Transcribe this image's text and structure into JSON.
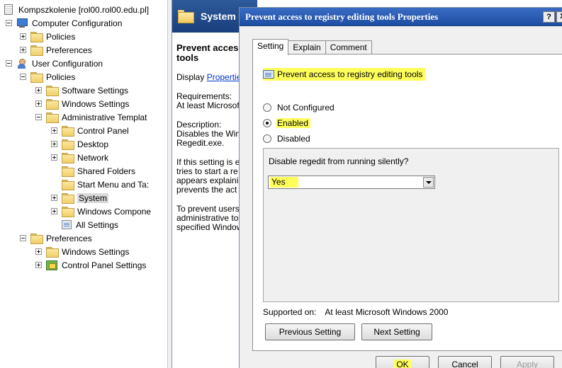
{
  "tree": {
    "root": "Kompszkolenie [rol00.rol00.edu.pl]",
    "computer_configuration": "Computer Configuration",
    "cc_policies": "Policies",
    "cc_preferences": "Preferences",
    "user_configuration": "User Configuration",
    "uc_policies": "Policies",
    "software_settings": "Software Settings",
    "windows_settings": "Windows Settings",
    "administrative_templates": "Administrative Templat",
    "control_panel": "Control Panel",
    "desktop": "Desktop",
    "network": "Network",
    "shared_folders": "Shared Folders",
    "start_menu": "Start Menu and Ta:",
    "system": "System",
    "windows_components": "Windows Compone",
    "all_settings": "All Settings",
    "uc_preferences": "Preferences",
    "pref_windows_settings": "Windows Settings",
    "pref_control_panel_settings": "Control Panel Settings"
  },
  "middle": {
    "header_title": "System",
    "setting_title_line1": "Prevent acces",
    "setting_title_line2": "tools",
    "display_prefix": "Display ",
    "display_link": "Propertie",
    "requirements_label": "Requirements:",
    "requirements_value": "At least Microsof",
    "description_label": "Description:",
    "description_line1": "Disables the Win",
    "description_line2": "Regedit.exe.",
    "para1_line1": "If this setting is e",
    "para1_line2": "tries to start a re",
    "para1_line3": "appears explainin",
    "para1_line4": "prevents the act",
    "para2_line1": "To prevent users",
    "para2_line2": "administrative to",
    "para2_line3": "specified Window"
  },
  "dialog": {
    "title": "Prevent access to registry editing tools Properties",
    "help_label": "?",
    "close_label": "X",
    "tabs": [
      "Setting",
      "Explain",
      "Comment"
    ],
    "policy_name": "Prevent access to registry editing tools",
    "radio_not_configured": "Not Configured",
    "radio_enabled": "Enabled",
    "radio_disabled": "Disabled",
    "selected_state": "Enabled",
    "options_label": "Disable regedit from running silently?",
    "select_value": "Yes",
    "supported_label": "Supported on:",
    "supported_value": "At least Microsoft Windows 2000",
    "prev_button": "Previous Setting",
    "next_button": "Next Setting",
    "ok_button": "OK",
    "cancel_button": "Cancel",
    "apply_button": "Apply"
  },
  "colors": {
    "highlight": "#ffff5c",
    "title_bar": "#2a5fb8",
    "link": "#0033cc"
  }
}
